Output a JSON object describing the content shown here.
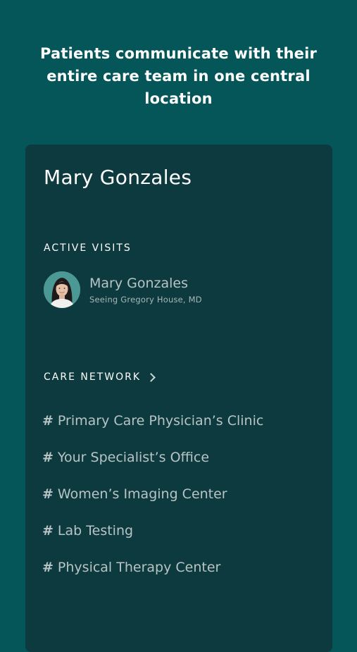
{
  "headline": "Patients communicate with their entire care team in one central location",
  "panel": {
    "title": "Mary Gonzales",
    "active_visits": {
      "label": "ACTIVE VISITS",
      "visit": {
        "name": "Mary Gonzales",
        "subtitle": "Seeing Gregory House, MD",
        "avatar": "patient-avatar-photo"
      }
    },
    "care_network": {
      "label": "CARE NETWORK",
      "chevron_icon": "chevron-right-icon",
      "hash_symbol": "#",
      "channels": [
        "Primary Care Physician’s Clinic",
        "Your Specialist’s Office",
        "Women’s Imaging Center",
        "Lab Testing",
        "Physical Therapy Center"
      ]
    }
  },
  "colors": {
    "background": "#045659",
    "panel": "#0d3a3e",
    "text_primary": "#ffffff",
    "text_muted": "#b8c4c4"
  }
}
